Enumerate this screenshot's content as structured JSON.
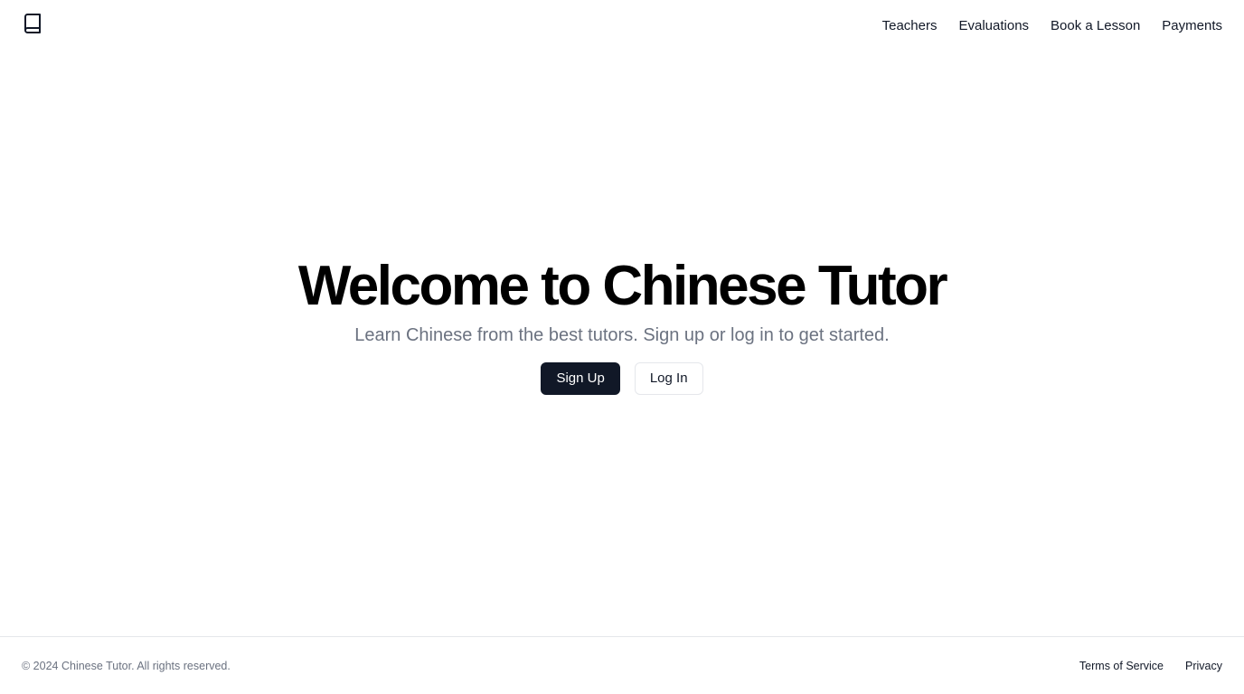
{
  "header": {
    "logo_icon": "book-icon",
    "nav": [
      {
        "label": "Teachers"
      },
      {
        "label": "Evaluations"
      },
      {
        "label": "Book a Lesson"
      },
      {
        "label": "Payments"
      }
    ]
  },
  "hero": {
    "title": "Welcome to Chinese Tutor",
    "subtitle": "Learn Chinese from the best tutors. Sign up or log in to get started.",
    "primary_button": "Sign Up",
    "secondary_button": "Log In"
  },
  "footer": {
    "copyright": "© 2024 Chinese Tutor. All rights reserved.",
    "links": [
      {
        "label": "Terms of Service"
      },
      {
        "label": "Privacy"
      }
    ]
  },
  "colors": {
    "primary": "#111827",
    "muted_text": "#6b7280",
    "border": "#e5e7eb"
  }
}
